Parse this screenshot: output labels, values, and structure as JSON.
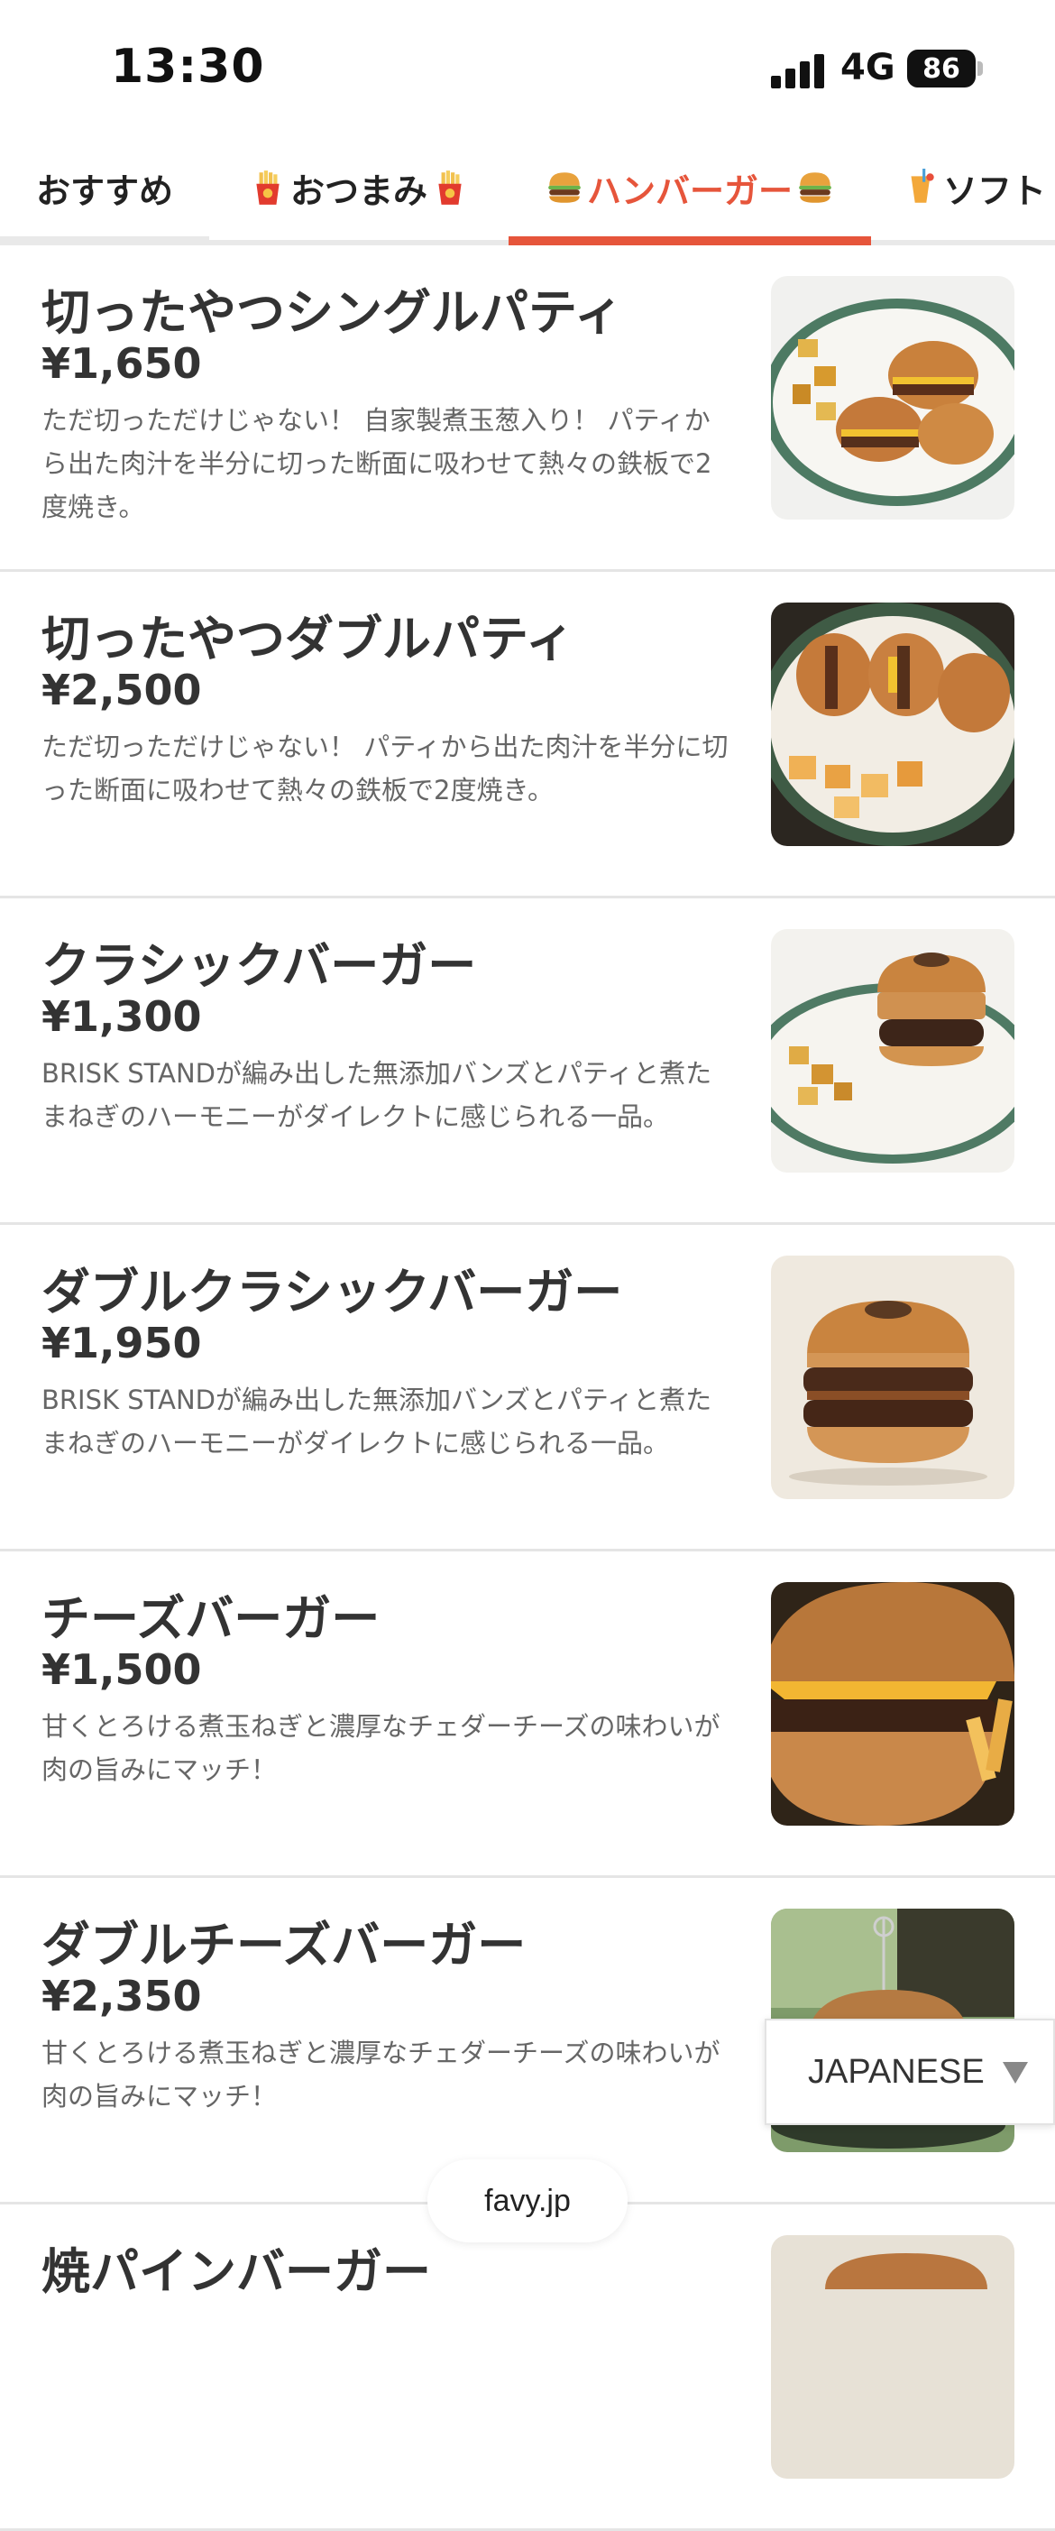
{
  "status_bar": {
    "time": "13:30",
    "network": "4G",
    "battery": "86"
  },
  "tabs": [
    {
      "label": "おすすめ",
      "icon": ""
    },
    {
      "label": "おつまみ",
      "icon": "fries-icon"
    },
    {
      "label": "ハンバーガー",
      "icon": "hamburger-icon",
      "active": true
    },
    {
      "label": "ソフト",
      "icon": "drink-icon"
    }
  ],
  "menu": [
    {
      "title": "切ったやつシングルパティ",
      "price": "¥1,650",
      "description": "ただ切っただけじゃない！ 自家製煮玉葱入り！ パティから出た肉汁を半分に切った断面に吸わせて熱々の鉄板で2度焼き。",
      "image": "cut-burger-plate-photo"
    },
    {
      "title": "切ったやつダブルパティ",
      "price": "¥2,500",
      "description": "ただ切っただけじゃない！ パティから出た肉汁を半分に切った断面に吸わせて熱々の鉄板で2度焼き。",
      "image": "cut-double-burger-plate-photo"
    },
    {
      "title": "クラシックバーガー",
      "price": "¥1,300",
      "description": "BRISK STANDが編み出した無添加バンズとパティと煮たまねぎのハーモニーがダイレクトに感じられる一品。",
      "image": "classic-burger-photo"
    },
    {
      "title": "ダブルクラシックバーガー",
      "price": "¥1,950",
      "description": "BRISK STANDが編み出した無添加バンズとパティと煮たまねぎのハーモニーがダイレクトに感じられる一品。",
      "image": "double-classic-burger-photo"
    },
    {
      "title": "チーズバーガー",
      "price": "¥1,500",
      "description": "甘くとろける煮玉ねぎと濃厚なチェダーチーズの味わいが肉の旨みにマッチ！",
      "image": "cheese-burger-photo"
    },
    {
      "title": "ダブルチーズバーガー",
      "price": "¥2,350",
      "description": "甘くとろける煮玉ねぎと濃厚なチェダーチーズの味わいが肉の旨みにマッチ！",
      "image": "double-cheese-burger-photo"
    },
    {
      "title": "焼パインバーガー",
      "price": "",
      "description": "",
      "image": "pineapple-burger-photo"
    }
  ],
  "language_select": {
    "value": "JAPANESE"
  },
  "footer": {
    "brand": "favy.jp"
  },
  "colors": {
    "accent": "#e6553b",
    "tab_border": "#e9e9e9",
    "text": "#333333",
    "muted_text": "#666666"
  }
}
